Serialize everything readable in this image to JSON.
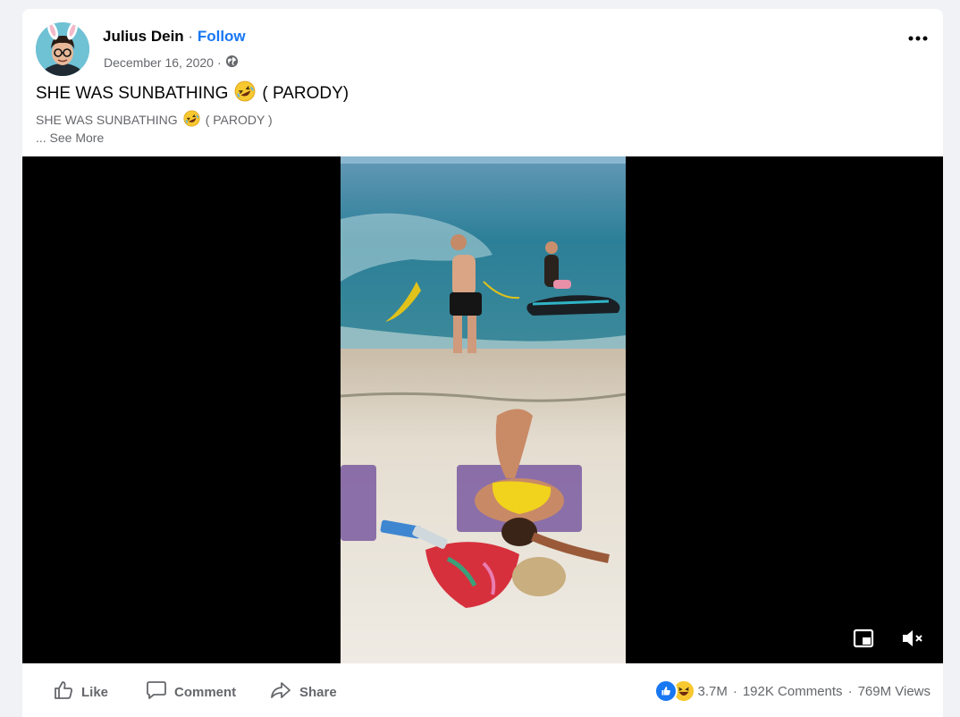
{
  "post": {
    "author": "Julius Dein",
    "follow_label": "Follow",
    "separator": "·",
    "date": "December 16, 2020",
    "date_separator": "·",
    "audience_icon": "globe-icon",
    "more_icon": "more-options-icon",
    "title_text": "SHE WAS SUNBATHING",
    "title_suffix": "( PARODY)",
    "subtitle_text": "SHE WAS SUNBATHING",
    "subtitle_suffix": "( PARODY )",
    "see_more": "... See More",
    "emoji": "rolling-on-floor-laughing-emoji"
  },
  "video": {
    "controls": {
      "pip_icon": "picture-in-picture-icon",
      "mute_icon": "volume-muted-icon"
    }
  },
  "footer": {
    "actions": [
      {
        "label": "Like",
        "icon": "thumbs-up-icon"
      },
      {
        "label": "Comment",
        "icon": "comment-icon"
      },
      {
        "label": "Share",
        "icon": "share-icon"
      }
    ],
    "reactions": [
      "like",
      "haha"
    ],
    "reaction_count": "3.7M",
    "dot": "·",
    "comments": "192K Comments",
    "views": "769M Views"
  },
  "colors": {
    "accent": "#1877f2",
    "secondary_text": "#65676b",
    "background": "#f0f2f5"
  }
}
